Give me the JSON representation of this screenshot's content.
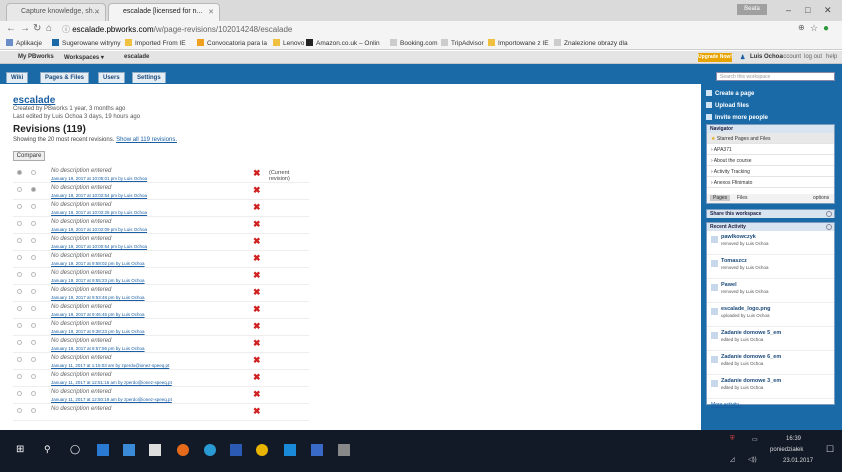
{
  "browser": {
    "tabs": [
      {
        "label": "Capture knowledge, sh...",
        "active": false
      },
      {
        "label": "escalade [licensed for n...",
        "active": true
      }
    ],
    "user_badge": "Beata",
    "url_host": "escalade.pbworks.com",
    "url_path": "/w/page-revisions/102014248/escalade",
    "bookmarks": [
      "Aplikacje",
      "Sugerowane witryny",
      "Imported From IE",
      "Convocatoria para la",
      "Lenovo",
      "Amazon.co.uk – Onlin",
      "Booking.com",
      "TripAdvisor",
      "Importowane z IE",
      "Znalezione obrazy dla"
    ]
  },
  "pbworks": {
    "top_links": {
      "my": "My PBworks",
      "workspaces": "Workspaces ▾",
      "space": "escalade"
    },
    "upgrade": "Upgrade Now!",
    "user": "Luis Ochoa",
    "account": "account",
    "logout": "log out",
    "help": "help",
    "tabs": [
      "Wiki",
      "Pages & Files",
      "Users",
      "Settings"
    ]
  },
  "page": {
    "title": "escalade",
    "created": "Created by PBworks 1 year, 3 months ago",
    "edited": "Last edited by Luis Ochoa 3 days, 19 hours ago",
    "revisions_heading": "Revisions (119)",
    "showing": "Showing the 20 most recent revisions.",
    "show_all": "Show all 119 revisions.",
    "compare": "Compare",
    "current": "(Current revision)"
  },
  "revisions": [
    {
      "desc": "No description entered",
      "date": "January 19, 2017 at 10:05:01 pm by Luis Ochoa"
    },
    {
      "desc": "No description entered",
      "date": "January 19, 2017 at 10:02:54 pm by Luis Ochoa"
    },
    {
      "desc": "No description entered",
      "date": "January 19, 2017 at 10:02:25 pm by Luis Ochoa"
    },
    {
      "desc": "No description entered",
      "date": "January 19, 2017 at 10:02:09 pm by Luis Ochoa"
    },
    {
      "desc": "No description entered",
      "date": "January 19, 2017 at 10:00:54 pm by Luis Ochoa"
    },
    {
      "desc": "No description entered",
      "date": "January 19, 2017 at 9:58:02 pm by Luis Ochoa"
    },
    {
      "desc": "No description entered",
      "date": "January 19, 2017 at 9:55:23 pm by Luis Ochoa"
    },
    {
      "desc": "No description entered",
      "date": "January 19, 2017 at 9:53:48 pm by Luis Ochoa"
    },
    {
      "desc": "No description entered",
      "date": "January 19, 2017 at 9:46:45 pm by Luis Ochoa"
    },
    {
      "desc": "No description entered",
      "date": "January 19, 2017 at 9:38:23 pm by Luis Ochoa"
    },
    {
      "desc": "No description entered",
      "date": "January 19, 2017 at 8:57:56 pm by Luis Ochoa"
    },
    {
      "desc": "No description entered",
      "date": "January 11, 2017 at 1:15:03 am by zperdo@ionez-speeq.pt"
    },
    {
      "desc": "No description entered",
      "date": "January 11, 2017 at 12:51:16 am by zperdo@ionez-speeq.pt"
    },
    {
      "desc": "No description entered",
      "date": "January 11, 2017 at 12:50:19 am by zperdo@ionez-speeq.pt"
    },
    {
      "desc": "No description entered",
      "date": ""
    }
  ],
  "sidebar": {
    "search_placeholder": "Search this workspace",
    "create": "Create a page",
    "upload": "Upload files",
    "invite": "Invite more people",
    "navigator": "Navigator",
    "nav_items": [
      "Starred Pages and Files",
      "APA371",
      "About the course",
      "Activity Tracking",
      "Anexos Ffinimato"
    ],
    "nav_pages": "Pages",
    "nav_files": "Files",
    "nav_options": "options",
    "share": "Share this workspace",
    "recent": "Recent Activity",
    "activity": [
      {
        "title": "pawlkowczyk",
        "sub": "removed by Luis Ochoa"
      },
      {
        "title": "Tomaszcz",
        "sub": "removed by Luis Ochoa"
      },
      {
        "title": "Pawel",
        "sub": "removed by Luis Ochoa"
      },
      {
        "title": "escalade_logo.png",
        "sub": "uploaded by Luis Ochoa"
      },
      {
        "title": "Zadanie domowe 5_em",
        "sub": "edited by Luis Ochoa"
      },
      {
        "title": "Zadanie domowe 6_em",
        "sub": "edited by Luis Ochoa"
      },
      {
        "title": "Zadanie domowe 3_em",
        "sub": "edited by Luis Ochoa"
      }
    ],
    "more": "More activity..."
  },
  "taskbar": {
    "time": "16:39",
    "day": "poniedziałek",
    "date": "23.01.2017"
  }
}
